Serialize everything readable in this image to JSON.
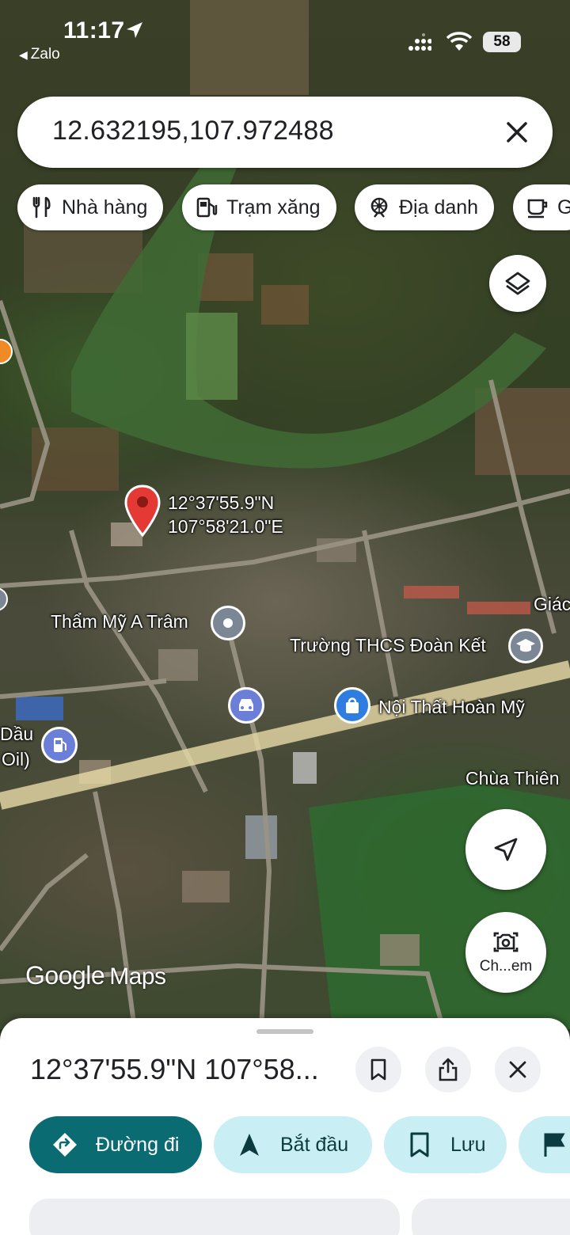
{
  "status_bar": {
    "time": "11:17",
    "back_app": "Zalo",
    "battery": "58"
  },
  "search": {
    "value": "12.632195,107.972488"
  },
  "chips": [
    {
      "label": "Nhà hàng",
      "icon": "restaurant-icon"
    },
    {
      "label": "Trạm xăng",
      "icon": "gas-station-icon"
    },
    {
      "label": "Địa danh",
      "icon": "landmark-icon"
    },
    {
      "label": "G",
      "icon": "coffee-icon"
    }
  ],
  "map": {
    "pin_lat": "12°37'55.9\"N",
    "pin_lng": "107°58'21.0\"E",
    "labels": {
      "tham_my": "Thẩm Mỹ A Trâm",
      "truong": "Trường THCS Đoàn Kết",
      "noi_that": "Nội Thất Hoàn Mỹ",
      "chua": "Chùa Thiên",
      "giao": "Giác",
      "dau": "Dầu",
      "oil": "Oil)"
    },
    "watermark_google": "Google",
    "watermark_maps": "Maps",
    "camera_label": "Ch...em"
  },
  "sheet": {
    "title": "12°37'55.9\"N 107°58...",
    "actions": [
      {
        "label": "Đường đi",
        "icon": "directions-icon"
      },
      {
        "label": "Bắt đầu",
        "icon": "navigation-arrow-icon"
      },
      {
        "label": "Lưu",
        "icon": "bookmark-icon"
      },
      {
        "label": "",
        "icon": "flag-icon"
      }
    ]
  },
  "colors": {
    "primary_action": "#0b6b72",
    "secondary_action": "#c9eef3",
    "pin": "#e53935",
    "road_main": "#e8dba8"
  }
}
